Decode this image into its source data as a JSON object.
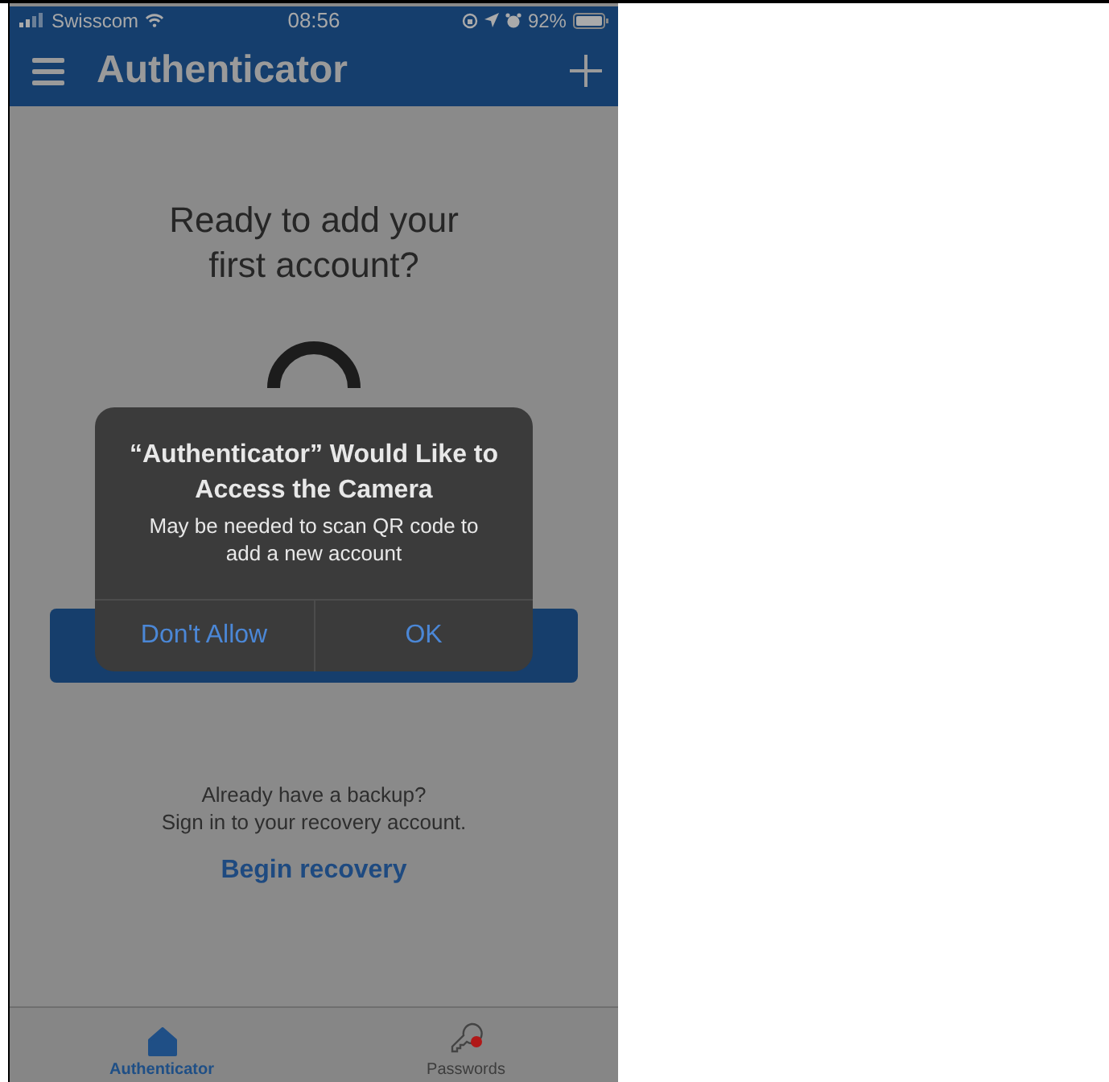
{
  "status_bar": {
    "carrier": "Swisscom",
    "time": "08:56",
    "battery": "92%"
  },
  "nav_bar": {
    "title": "Authenticator"
  },
  "empty_state": {
    "heading": "Ready to add your first account?"
  },
  "alert": {
    "title": "“Authenticator” Would Like to Access the Camera",
    "message": "May be needed to scan QR code to add a new account",
    "buttons": [
      "Don't Allow",
      "OK"
    ]
  },
  "recovery": {
    "lines": [
      "Already have a backup?",
      "Sign in to your recovery account."
    ],
    "link": "Begin recovery"
  },
  "tab_bar": [
    {
      "label": "Authenticator",
      "kind": "home",
      "selected": true
    },
    {
      "label": "Passwords",
      "kind": "key",
      "selected": false
    }
  ]
}
